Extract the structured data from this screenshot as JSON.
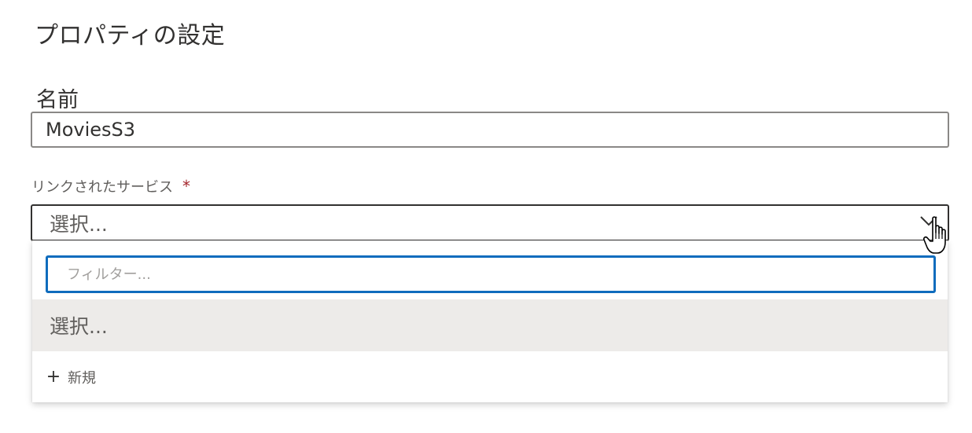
{
  "panel": {
    "title": "プロパティの設定"
  },
  "name_field": {
    "label": "名前",
    "value": "MoviesS3"
  },
  "linked_service": {
    "label": "リンクされたサービス",
    "required_marker": "*",
    "placeholder": "選択...",
    "chevron_icon": "chevron-down-icon"
  },
  "dropdown": {
    "filter_placeholder": "フィルター...",
    "options": [
      {
        "label": "選択...",
        "selected": true
      }
    ],
    "new_item": {
      "icon": "plus-icon",
      "symbol": "+",
      "label": "新規"
    }
  },
  "colors": {
    "focus_border": "#0f6cbd",
    "required": "#a4262c",
    "selected_bg": "#edebe9"
  }
}
